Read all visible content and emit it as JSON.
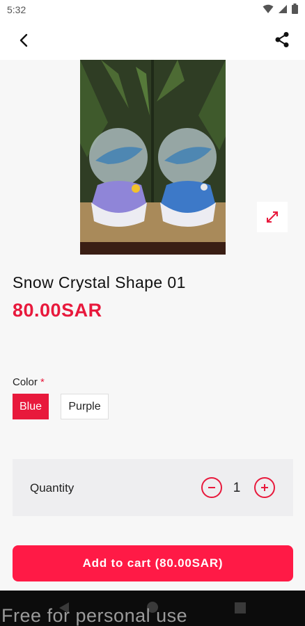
{
  "status_bar": {
    "time": "5:32"
  },
  "product": {
    "title": "Snow Crystal Shape 01",
    "price": "80.00SAR"
  },
  "options": {
    "color_label": "Color",
    "required_marker": "*",
    "colors": [
      "Blue",
      "Purple"
    ],
    "selected_color": "Blue"
  },
  "quantity": {
    "label": "Quantity",
    "value": "1"
  },
  "cart_button": {
    "label": "Add to cart (80.00SAR)"
  },
  "watermark": "Free for personal use",
  "icons": {
    "back": "back-arrow-icon",
    "share": "share-icon",
    "expand": "expand-icon",
    "minus": "minus-icon",
    "plus": "plus-icon"
  },
  "colors": {
    "accent": "#e8193c",
    "button": "#ff1a46"
  }
}
